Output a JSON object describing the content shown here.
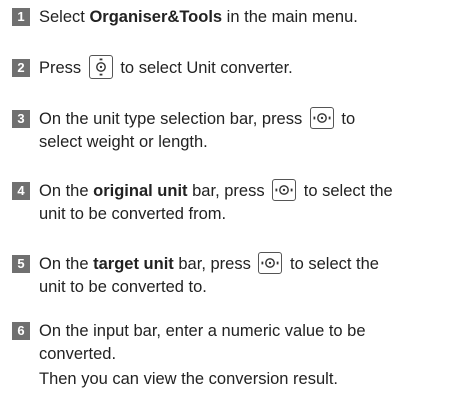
{
  "steps": [
    {
      "num": "1",
      "pre": "Select ",
      "bold": "Organiser&Tools",
      "post": " in the main menu."
    },
    {
      "num": "2",
      "pre": "Press ",
      "post": " to select Unit converter."
    },
    {
      "num": "3",
      "pre": "On the unit type selection bar, press ",
      "post": " to",
      "line2": "select weight or length."
    },
    {
      "num": "4",
      "pre": "On the ",
      "bold": "original unit",
      "mid": " bar, press ",
      "post": " to select the",
      "line2": "unit to be converted from."
    },
    {
      "num": "5",
      "pre": "On the ",
      "bold": "target unit",
      "mid": " bar, press ",
      "post": " to select the",
      "line2": "unit to be converted to."
    },
    {
      "num": "6",
      "line1": "On the input bar, enter a numeric value to be",
      "line2": "converted."
    }
  ],
  "note": "Then you can view the conversion result.",
  "icons": {
    "step2_key": "nav-key-up-down-icon",
    "step3_key": "nav-key-left-right-icon",
    "step4_key": "nav-key-left-right-icon",
    "step5_key": "nav-key-left-right-icon"
  }
}
